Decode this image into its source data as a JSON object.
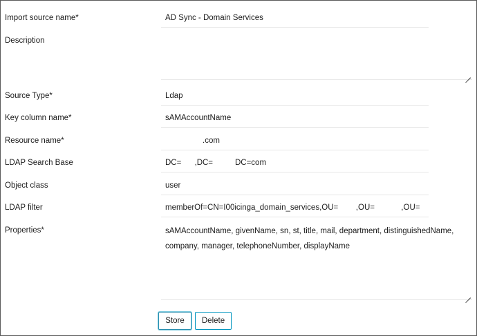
{
  "form": {
    "fields": [
      {
        "label": "Import source name*",
        "value": "AD Sync - Domain Services"
      },
      {
        "label": "Description",
        "value": ""
      },
      {
        "label": "Source Type*",
        "value": "Ldap"
      },
      {
        "label": "Key column name*",
        "value": "sAMAccountName"
      },
      {
        "label": "Resource name*",
        "value": ".com"
      },
      {
        "label": "LDAP Search Base",
        "value": "DC=      ,DC=          DC=com"
      },
      {
        "label": "Object class",
        "value": "user"
      },
      {
        "label": "LDAP filter",
        "value": "memberOf=CN=I00icinga_domain_services,OU=        ,OU=            ,OU="
      },
      {
        "label": "Properties*",
        "value": "sAMAccountName, givenName, sn, st, title, mail, department, distinguishedName, company, manager, telephoneNumber, displayName"
      }
    ],
    "buttons": {
      "store": "Store",
      "delete": "Delete"
    }
  },
  "colors": {
    "border": "#5a5a5a",
    "accent": "#0095bf",
    "underline": "#e6e6e6"
  }
}
